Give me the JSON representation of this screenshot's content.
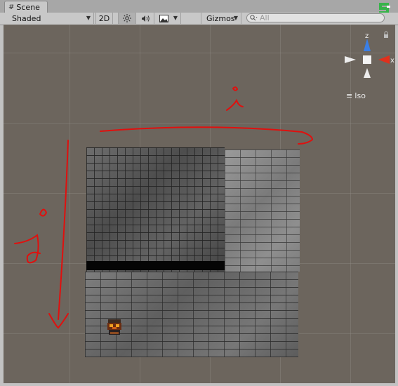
{
  "tabs": [
    {
      "label": "Scene",
      "icon": "grid-hash-icon"
    }
  ],
  "toolbar": {
    "draw_mode": "Shaded",
    "mode_2d": "2D",
    "lighting_icon": "sun-icon",
    "audio_icon": "speaker-icon",
    "effects_icon": "image-icon",
    "gizmos": "Gizmos",
    "search_placeholder": "All"
  },
  "orientation_gizmo": {
    "axis_z": "z",
    "axis_x": "x",
    "projection": "Iso"
  },
  "annotations": {
    "top_label": "x",
    "left_label": "y"
  },
  "colors": {
    "viewport_bg": "#6c655d",
    "gizmo_x": "#e0301c",
    "gizmo_z": "#3a7fe6",
    "annotation": "#e0100e",
    "brand_logo": "#37b34a"
  }
}
